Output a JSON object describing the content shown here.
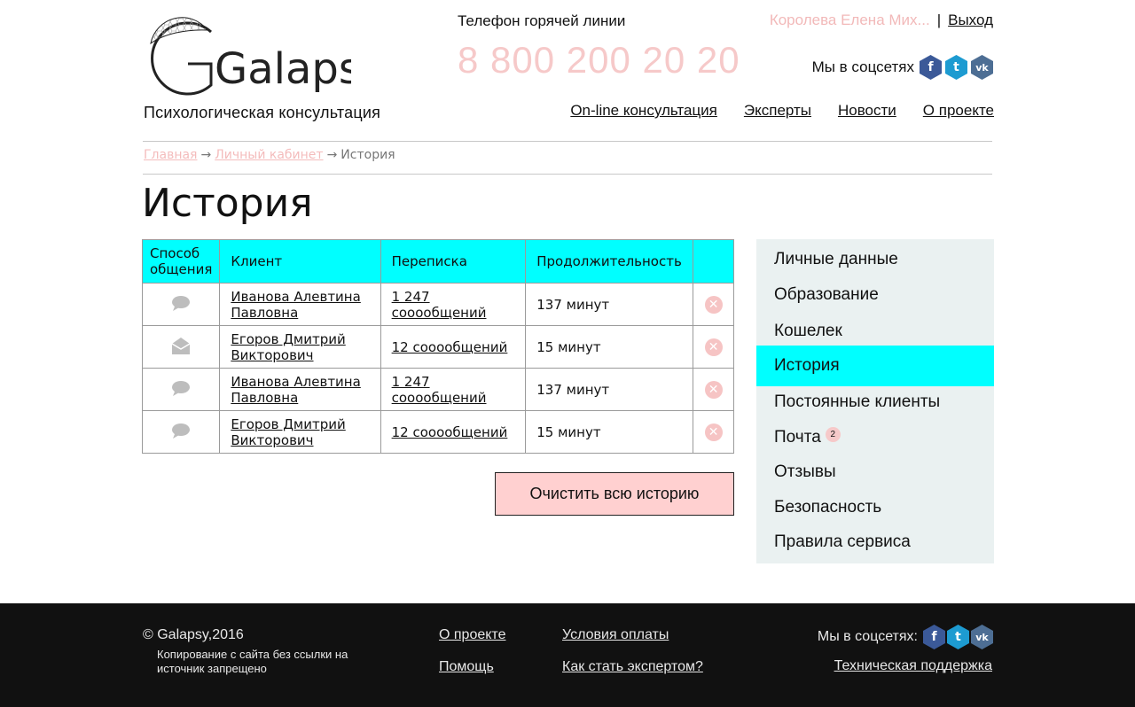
{
  "header": {
    "logo_text": "Galapsy",
    "tagline": "Психологическая консультация",
    "hotline_label": "Телефон горячей линии",
    "hotline_phone": "8 800 200 20 20",
    "user_name": "Королева Елена Мих...",
    "separator": "|",
    "logout": "Выход",
    "social_label": "Мы в соцсетях",
    "social": {
      "fb": "f",
      "tw": "t",
      "vk": "vk"
    }
  },
  "topnav": [
    {
      "label": "On-line консультация"
    },
    {
      "label": "Эксперты"
    },
    {
      "label": "Новости"
    },
    {
      "label": "О проекте"
    }
  ],
  "breadcrumb": {
    "home": "Главная",
    "arrow1": "→",
    "cabinet": "Личный кабинет",
    "arrow2": "→",
    "current": "История"
  },
  "page_title": "История",
  "table": {
    "headers": [
      "Способ общения",
      "Клиент",
      "Переписка",
      "Продолжительность",
      ""
    ],
    "rows": [
      {
        "method_icon": "chat-bubble-icon",
        "client": "Иванова Алевтина Павловна",
        "messages": "1 247 сооообщений",
        "duration": "137 минут"
      },
      {
        "method_icon": "envelope-open-icon",
        "client": "Егоров Дмитрий Викторович",
        "messages": "12 сооообщений",
        "duration": "15 минут"
      },
      {
        "method_icon": "chat-bubble-icon",
        "client": "Иванова Алевтина Павловна",
        "messages": "1 247 сооообщений",
        "duration": "137 минут"
      },
      {
        "method_icon": "chat-bubble-icon",
        "client": "Егоров Дмитрий Викторович",
        "messages": "12 сооообщений",
        "duration": "15 минут"
      }
    ]
  },
  "clear_button": "Очистить всю историю",
  "sidemenu": {
    "items": [
      {
        "label": "Личные данные"
      },
      {
        "label": "Образование"
      },
      {
        "label": "Кошелек"
      },
      {
        "label": "История"
      },
      {
        "label": "Постоянные клиенты"
      },
      {
        "label": "Почта",
        "badge": "2"
      },
      {
        "label": "Отзывы"
      },
      {
        "label": "Безопасность"
      },
      {
        "label": "Правила сервиса"
      }
    ],
    "active_index": 3
  },
  "footer": {
    "copyright": "© Galapsy,2016",
    "note": "Копирование с сайта без ссылки на источник запрещено",
    "links": {
      "about": "О проекте",
      "help": "Помощь",
      "payment": "Условия оплаты",
      "become_expert": "Как стать экспертом?"
    },
    "social_label": "Мы в соцсетях:",
    "support": "Техническая поддержка"
  },
  "colors": {
    "accent_cyan": "#00ffff",
    "pink": "#f6c9c9",
    "button_pink": "#ffd0d0",
    "sidebar_bg": "#eaf1f1",
    "footer_bg": "#111111"
  }
}
